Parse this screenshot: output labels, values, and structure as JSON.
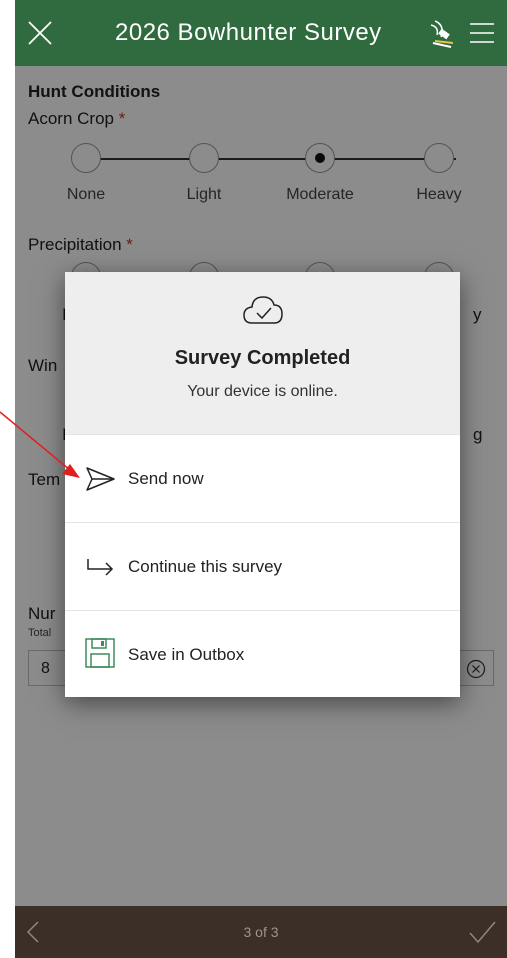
{
  "header": {
    "title": "2026 Bowhunter Survey",
    "close_icon": "close-icon",
    "gps_icon": "gps-satellite-icon",
    "menu_icon": "hamburger-menu-icon",
    "bg_color": "#2f6b3e"
  },
  "form": {
    "section_title": "Hunt Conditions",
    "acorn": {
      "label": "Acorn Crop",
      "required_mark": "*",
      "options": [
        "None",
        "Light",
        "Moderate",
        "Heavy"
      ],
      "selected": "Moderate"
    },
    "precipitation": {
      "label": "Precipitation",
      "required_mark": "*"
    },
    "partial": {
      "wind_label": "Win",
      "temp_label": "Tem",
      "number_label": "Nur",
      "total_hint": "Total",
      "number_value": "8",
      "left_fragment_1": "I",
      "left_fragment_2": "I",
      "right_fragment_1": "y",
      "right_fragment_2": "g"
    }
  },
  "dialog": {
    "cloud_icon": "cloud-check-icon",
    "title": "Survey Completed",
    "subtitle": "Your device is online.",
    "actions": [
      {
        "label": "Send now",
        "icon": "send-icon"
      },
      {
        "label": "Continue this survey",
        "icon": "arrow-return-icon"
      },
      {
        "label": "Save in Outbox",
        "icon": "save-floppy-icon"
      }
    ]
  },
  "footer": {
    "page_indicator": "3 of 3",
    "back_icon": "chevron-left-icon",
    "submit_icon": "checkmark-icon",
    "bg_color": "#3b2f28"
  },
  "annotation": {
    "arrow_color": "#e02020"
  }
}
